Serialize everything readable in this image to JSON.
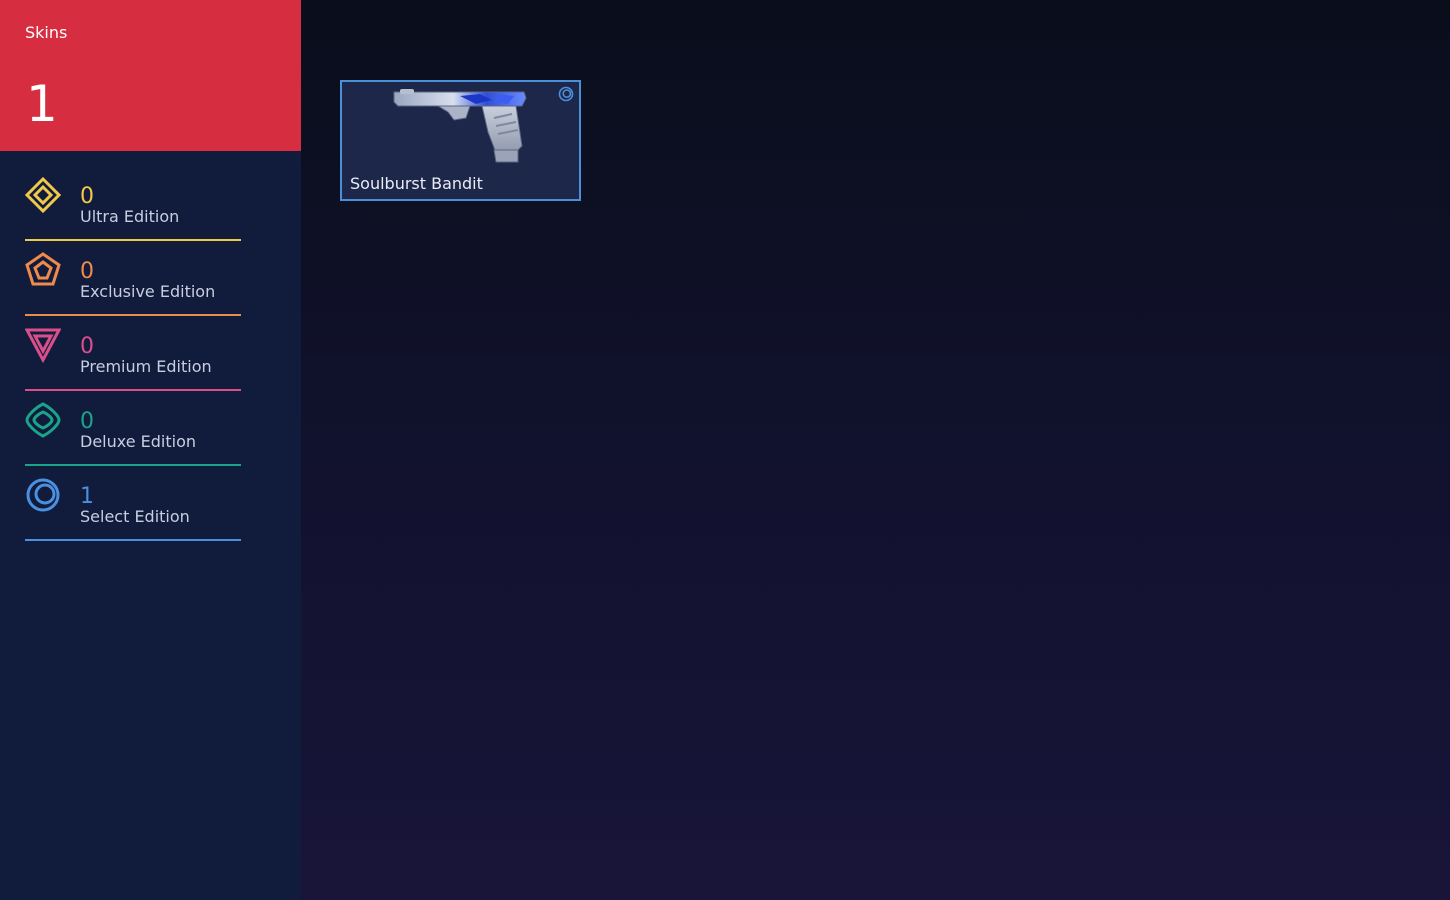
{
  "summary": {
    "label": "Skins",
    "count": "1",
    "color": "#d62d41"
  },
  "tiers": [
    {
      "count": "0",
      "name": "Ultra Edition",
      "color": "#f0c94a",
      "icon": "ultra-edition-icon"
    },
    {
      "count": "0",
      "name": "Exclusive Edition",
      "color": "#f08a4b",
      "icon": "exclusive-edition-icon"
    },
    {
      "count": "0",
      "name": "Premium Edition",
      "color": "#d94f8a",
      "icon": "premium-edition-icon"
    },
    {
      "count": "0",
      "name": "Deluxe Edition",
      "color": "#1aa58a",
      "icon": "deluxe-edition-icon"
    },
    {
      "count": "1",
      "name": "Select Edition",
      "color": "#4a8fe0",
      "icon": "select-edition-icon"
    }
  ],
  "skins": [
    {
      "name": "Soulburst Bandit",
      "tier_icon": "select-edition-icon",
      "border_color": "#4a90d9"
    }
  ]
}
